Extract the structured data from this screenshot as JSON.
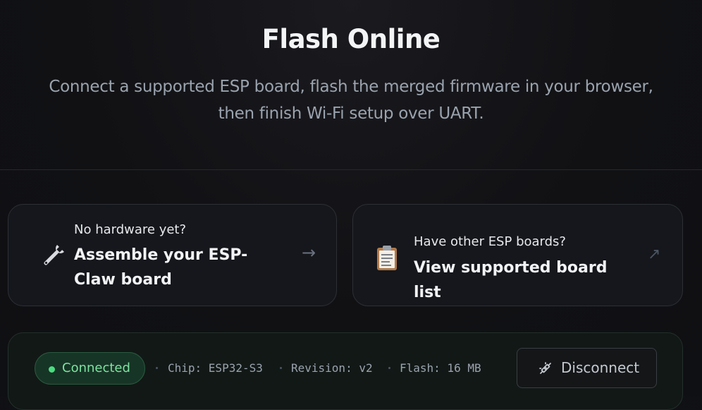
{
  "hero": {
    "title": "Flash Online",
    "subtitle_line1": "Connect a supported ESP board, flash the merged firmware in your browser,",
    "subtitle_line2": "then finish Wi-Fi setup over UART."
  },
  "cards": [
    {
      "eyebrow": "No hardware yet?",
      "title": "Assemble your ESP-Claw board",
      "icon": "wrench-icon",
      "arrow": "→"
    },
    {
      "eyebrow": "Have other ESP boards?",
      "title": "View supported board list",
      "icon": "clipboard-icon",
      "arrow": "↗"
    }
  ],
  "status": {
    "badge_label": "Connected",
    "chip": "Chip: ESP32-S3",
    "revision": "Revision: v2",
    "flash": "Flash: 16 MB",
    "disconnect_label": "Disconnect",
    "badge_color": "#4ade80"
  }
}
